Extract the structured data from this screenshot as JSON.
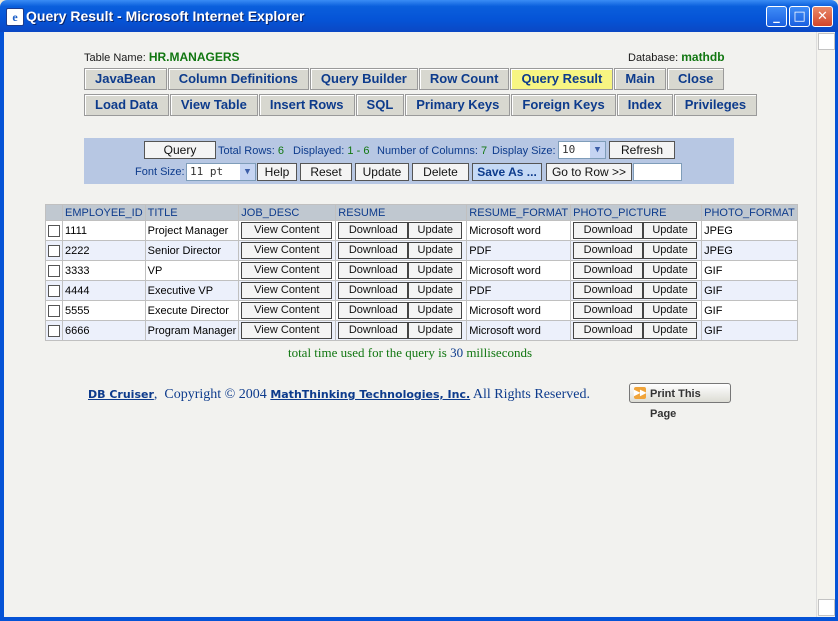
{
  "window": {
    "title": "Query Result - Microsoft Internet Explorer"
  },
  "meta": {
    "table_label": "Table Name:",
    "table_name": "HR.MANAGERS",
    "db_label": "Database:",
    "db_name": "mathdb"
  },
  "nav_row1": [
    "JavaBean",
    "Column Definitions",
    "Query Builder",
    "Row Count",
    "Query Result",
    "Main",
    "Close"
  ],
  "nav_row2": [
    "Load Data",
    "View Table",
    "Insert Rows",
    "SQL",
    "Primary Keys",
    "Foreign Keys",
    "Index",
    "Privileges"
  ],
  "active_tab": "Query Result",
  "controls": {
    "query": "Query",
    "total_rows_label": "Total Rows:",
    "total_rows": "6",
    "displayed_label": "Displayed:",
    "displayed": "1 - 6",
    "columns_label": "Number of Columns:",
    "columns": "7",
    "display_size_label": "Display Size:",
    "display_size": "10",
    "refresh": "Refresh",
    "font_size_label": "Font Size:",
    "font_size": "11 pt",
    "help": "Help",
    "reset": "Reset",
    "update": "Update",
    "delete": "Delete",
    "save_as": "Save As ...",
    "go_to_row": "Go to Row >>"
  },
  "table": {
    "headers": [
      "EMPLOYEE_ID",
      "TITLE",
      "JOB_DESC",
      "RESUME",
      "RESUME_FORMAT",
      "PHOTO_PICTURE",
      "PHOTO_FORMAT"
    ],
    "view_label": "View Content",
    "download_label": "Download",
    "update_label": "Update",
    "rows": [
      {
        "id": "1111",
        "title": "Project Manager",
        "resume_format": "Microsoft word",
        "photo_format": "JPEG"
      },
      {
        "id": "2222",
        "title": "Senior Director",
        "resume_format": "PDF",
        "photo_format": "JPEG"
      },
      {
        "id": "3333",
        "title": "VP",
        "resume_format": "Microsoft word",
        "photo_format": "GIF"
      },
      {
        "id": "4444",
        "title": "Executive VP",
        "resume_format": "PDF",
        "photo_format": "GIF"
      },
      {
        "id": "5555",
        "title": "Execute Director",
        "resume_format": "Microsoft word",
        "photo_format": "GIF"
      },
      {
        "id": "6666",
        "title": "Program Manager",
        "resume_format": "Microsoft word",
        "photo_format": "GIF"
      }
    ]
  },
  "timing": {
    "prefix": "total time used for the query is",
    "value": "30",
    "suffix": "milliseconds"
  },
  "footer": {
    "product": "DB Cruiser",
    "copyright": "Copyright © 2004",
    "company": "MathThinking Technologies, Inc.",
    "rights": "All Rights Reserved.",
    "print": "Print This Page"
  }
}
